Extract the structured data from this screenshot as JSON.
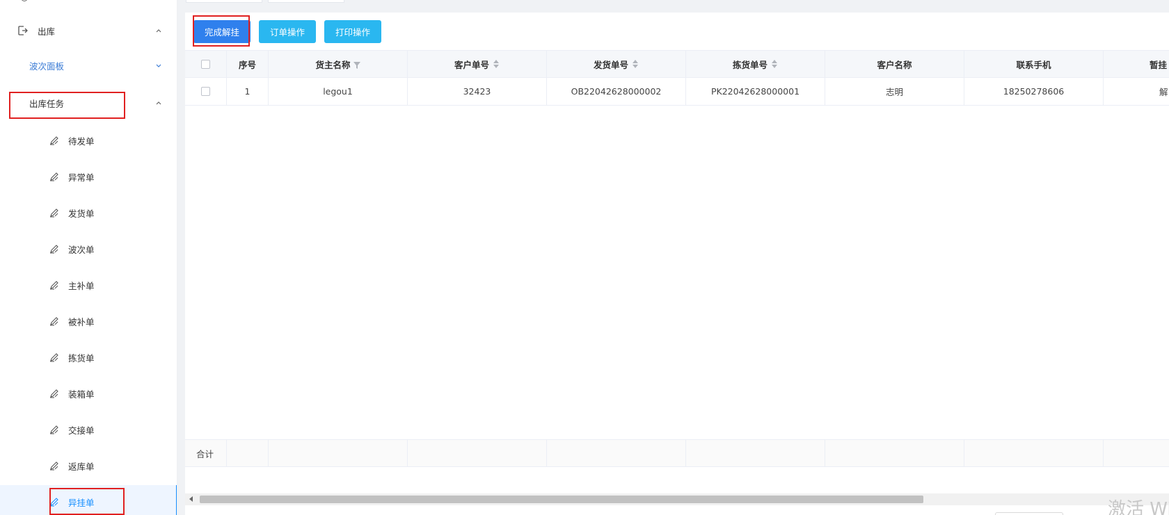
{
  "sidebar": {
    "outbound": {
      "label": "出库",
      "icon": "logout-icon",
      "expanded": true
    },
    "wave_panel": {
      "label": "波次面板",
      "expanded": false
    },
    "outbound_task": {
      "label": "出库任务",
      "expanded": true
    },
    "items": [
      {
        "label": "待发单",
        "icon": "edit-pen-icon"
      },
      {
        "label": "异常单",
        "icon": "edit-pen-icon"
      },
      {
        "label": "发货单",
        "icon": "edit-pen-icon"
      },
      {
        "label": "波次单",
        "icon": "edit-pen-icon"
      },
      {
        "label": "主补单",
        "icon": "edit-pen-icon"
      },
      {
        "label": "被补单",
        "icon": "edit-pen-icon"
      },
      {
        "label": "拣货单",
        "icon": "edit-pen-icon"
      },
      {
        "label": "装箱单",
        "icon": "edit-pen-icon"
      },
      {
        "label": "交接单",
        "icon": "edit-pen-icon"
      },
      {
        "label": "返库单",
        "icon": "edit-pen-icon"
      },
      {
        "label": "异挂单",
        "icon": "edit-pen-icon",
        "active": true
      }
    ]
  },
  "toolbar": {
    "complete_unhang_label": "完成解挂",
    "order_ops_label": "订单操作",
    "print_ops_label": "打印操作"
  },
  "table": {
    "columns": [
      "序号",
      "货主名称",
      "客户单号",
      "发货单号",
      "拣货单号",
      "客户名称",
      "联系手机",
      "暂挂"
    ],
    "rows": [
      {
        "index": "1",
        "owner": "legou1",
        "customer_no": "32423",
        "ship_no": "OB22042628000002",
        "pick_no": "PK22042628000001",
        "customer_name": "志明",
        "phone": "18250278606",
        "hold": "解"
      }
    ],
    "footer_label": "合计"
  },
  "colors": {
    "primary": "#2f80ed",
    "info": "#2ab7f0",
    "active_menu": "#1890ff",
    "highlight_box": "#e02020"
  },
  "watermark": "激活 Wi"
}
